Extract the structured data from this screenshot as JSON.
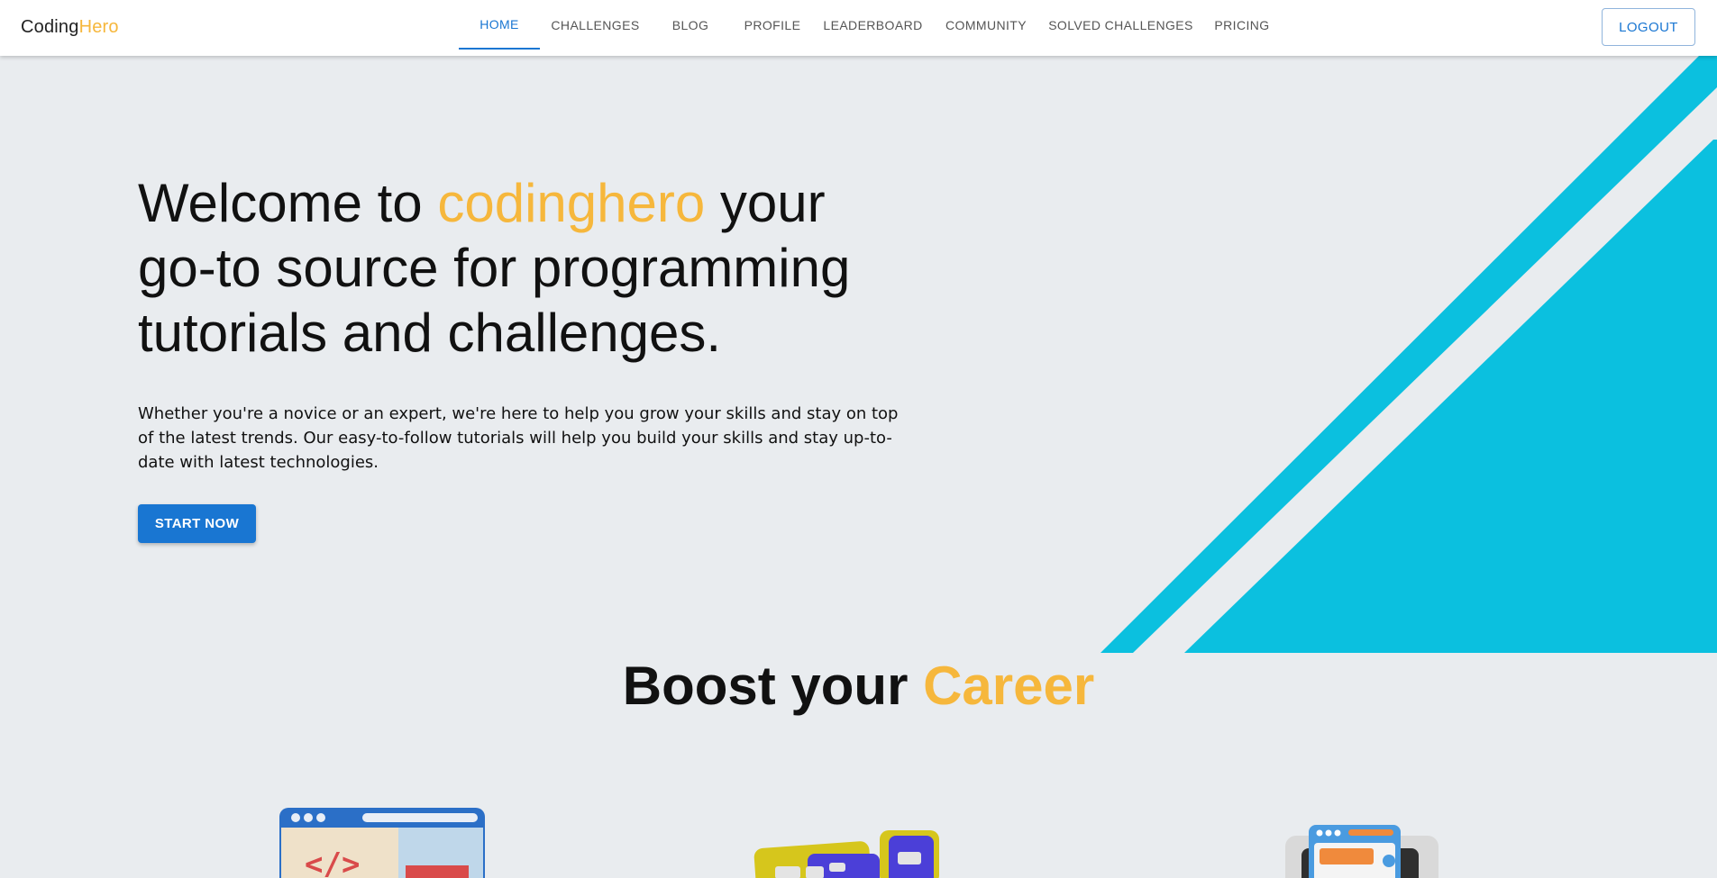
{
  "brand": {
    "part1": "Coding",
    "part2": "Hero"
  },
  "nav": {
    "items": [
      {
        "label": "HOME",
        "active": true
      },
      {
        "label": "CHALLENGES",
        "active": false
      },
      {
        "label": "BLOG",
        "active": false
      },
      {
        "label": "PROFILE",
        "active": false
      },
      {
        "label": "LEADERBOARD",
        "active": false
      },
      {
        "label": "COMMUNITY",
        "active": false
      },
      {
        "label": "SOLVED CHALLENGES",
        "active": false
      },
      {
        "label": "PRICING",
        "active": false
      }
    ],
    "logout_label": "LOGOUT"
  },
  "hero": {
    "title_before": "Welcome to ",
    "title_accent": "codinghero",
    "title_after": " your go-to source for programming tutorials and challenges.",
    "description": "Whether you're a novice or an expert, we're here to help you grow your skills and stay on top of the latest trends. Our easy-to-follow tutorials will help you build your skills and stay up-to-date with latest technologies.",
    "cta_label": "START NOW"
  },
  "career": {
    "title_before": "Boost your ",
    "title_accent": "Career"
  },
  "colors": {
    "primary": "#1976d2",
    "accent": "#f6b73c",
    "decor": "#0bc0df",
    "background": "#e9ecef"
  },
  "illustrations": [
    "code-window-icon",
    "cards-icon",
    "profile-window-icon"
  ]
}
